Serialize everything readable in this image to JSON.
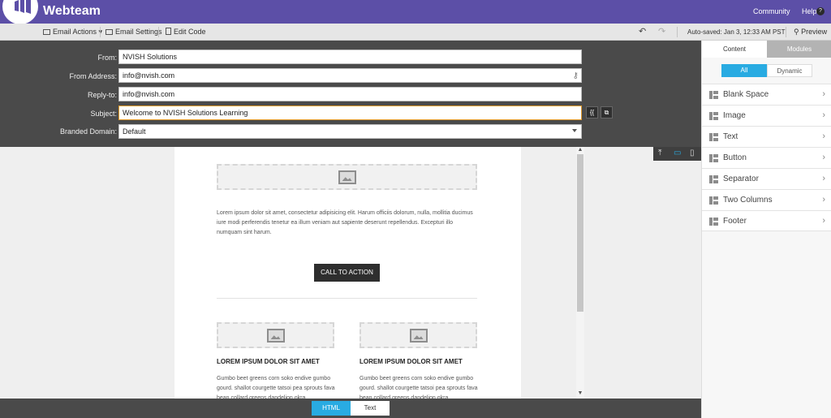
{
  "app": {
    "title": "Webteam",
    "community": "Community",
    "help": "Help"
  },
  "toolbar": {
    "email_actions": "Email Actions ▾",
    "email_settings": "Email Settings",
    "edit_code": "Edit Code",
    "autosave": "Auto-saved: Jan 3, 12:33 AM PST",
    "preview": "Preview"
  },
  "settings": {
    "from": {
      "label": "From:",
      "value": "NVISH Solutions"
    },
    "from_address": {
      "label": "From Address:",
      "value": "info@nvish.com"
    },
    "reply_to": {
      "label": "Reply-to:",
      "value": "info@nvish.com"
    },
    "subject": {
      "label": "Subject:",
      "value": "Welcome to NVISH Solutions Learning"
    },
    "branded_domain": {
      "label": "Branded Domain:",
      "value": "Default"
    }
  },
  "email": {
    "body_text": "Lorem ipsum dolor sit amet, consectetur adipisicing elit. Harum officiis dolorum, nulla, mollitia ducimus iure modi perferendis tenetur ea illum veniam aut sapiente deserunt repellendus. Excepturi illo numquam sint harum.",
    "cta_label": "CALL TO ACTION",
    "col1_heading": "LOREM IPSUM DOLOR SIT AMET",
    "col2_heading": "LOREM IPSUM DOLOR SIT AMET",
    "col_text": "Gumbo beet greens corn soko endive gumbo gourd. shallot courgette tatsoi pea sprouts fava bean collard greens dandelion okra"
  },
  "bottom_tabs": {
    "html": "HTML",
    "text": "Text"
  },
  "right_panel": {
    "tabs": {
      "content": "Content",
      "modules": "Modules"
    },
    "filter": {
      "all": "All",
      "dynamic": "Dynamic"
    },
    "modules": [
      "Blank Space",
      "Image",
      "Text",
      "Button",
      "Separator",
      "Two Columns",
      "Footer"
    ]
  },
  "colors": {
    "header": "#5c4fa7",
    "accent": "#29abe2",
    "panel_dark": "#4a4a4a"
  }
}
